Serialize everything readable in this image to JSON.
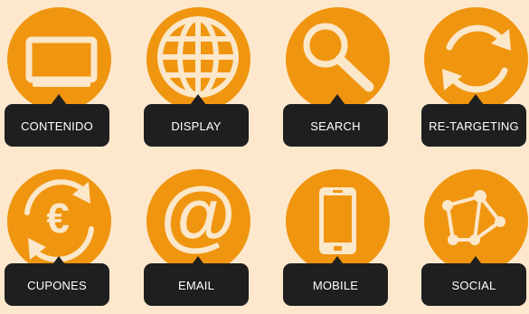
{
  "colors": {
    "background": "#fde8cd",
    "circle": "#f0950f",
    "icon": "#fbe7c9",
    "label_bg": "#1f1f1f",
    "label_text": "#ffffff"
  },
  "tiles": [
    {
      "label": "CONTENIDO",
      "icon": "monitor-icon"
    },
    {
      "label": "DISPLAY",
      "icon": "globe-icon"
    },
    {
      "label": "SEARCH",
      "icon": "magnifier-icon"
    },
    {
      "label": "RE-TARGETING",
      "icon": "refresh-arrows-icon"
    },
    {
      "label": "CUPONES",
      "icon": "euro-cycle-icon"
    },
    {
      "label": "EMAIL",
      "icon": "at-sign-icon"
    },
    {
      "label": "MOBILE",
      "icon": "smartphone-icon"
    },
    {
      "label": "SOCIAL",
      "icon": "network-graph-icon"
    }
  ]
}
